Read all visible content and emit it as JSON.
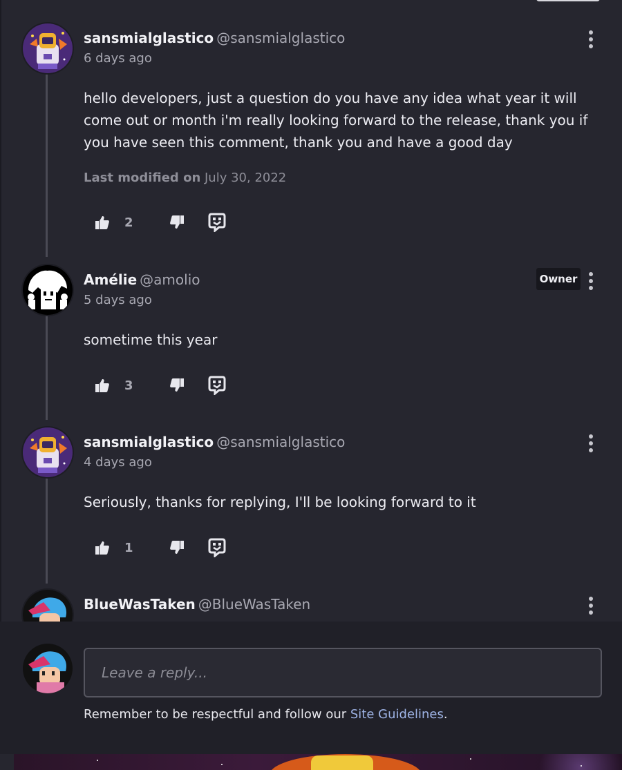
{
  "comments": [
    {
      "name": "sansmialglastico",
      "handle": "@sansmialglastico",
      "time": "6 days ago",
      "body": "hello developers, just a question do you have any idea what year it will come out or month i'm really looking forward to the release, thank you if you have seen this comment, thank you and have a good day",
      "modified_label": "Last modified on",
      "modified_date": "July 30, 2022",
      "likes": "2",
      "avatar_icon": "astronaut-avatar-icon"
    },
    {
      "name": "Amélie",
      "handle": "@amolio",
      "badge": "Owner",
      "time": "5 days ago",
      "body": "sometime this year",
      "likes": "3",
      "avatar_icon": "bw-character-avatar-icon"
    },
    {
      "name": "sansmialglastico",
      "handle": "@sansmialglastico",
      "time": "4 days ago",
      "body": "Seriously, thanks for replying, I'll be looking forward to it",
      "likes": "1",
      "avatar_icon": "astronaut-avatar-icon"
    },
    {
      "name": "BlueWasTaken",
      "handle": "@BlueWasTaken",
      "avatar_icon": "blue-hair-character-avatar-icon"
    }
  ],
  "reply_box": {
    "placeholder": "Leave a reply...",
    "notice_text": "Remember to be respectful and follow our ",
    "notice_link": "Site Guidelines",
    "notice_end": "."
  },
  "icons": {
    "like": "thumbs-up-icon",
    "dislike": "thumbs-down-icon",
    "reply": "reply-icon",
    "more": "kebab-menu-icon"
  },
  "colors": {
    "background": "#26262f",
    "reply_bar": "#202028",
    "link": "#9fb4e6",
    "muted": "#a8a8b2"
  }
}
